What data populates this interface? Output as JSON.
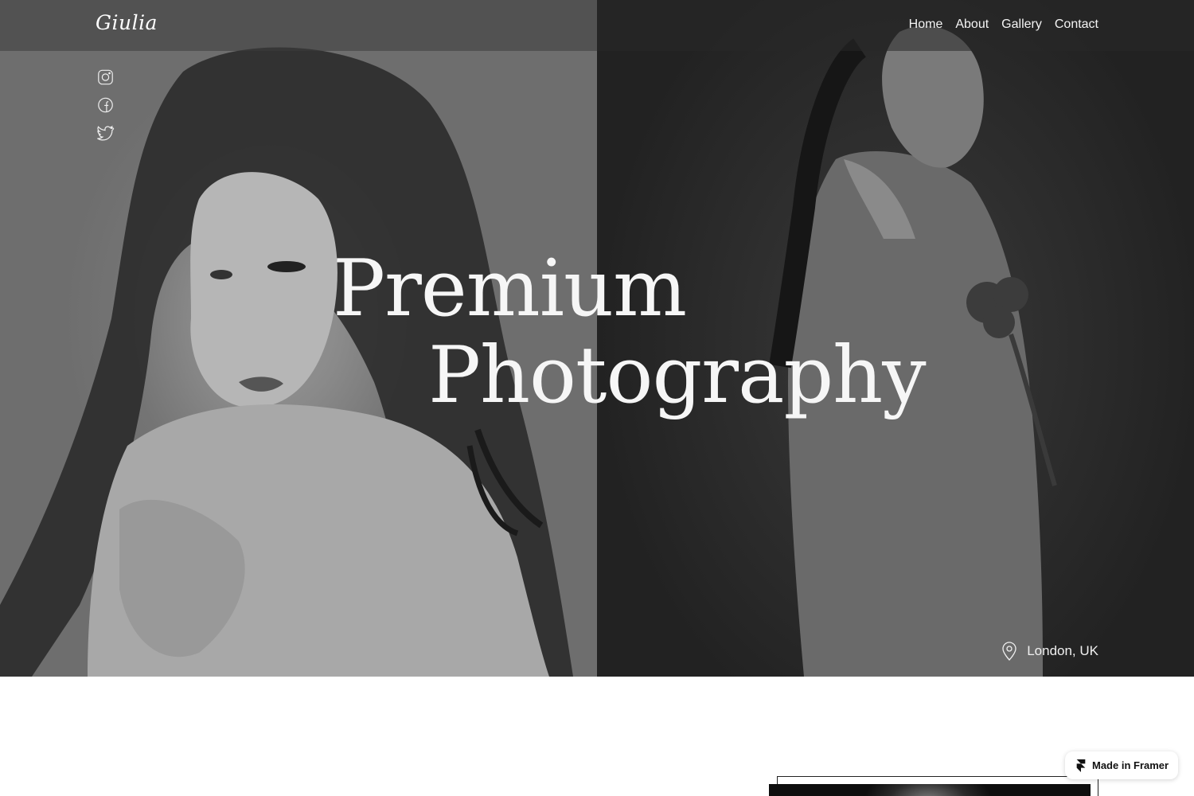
{
  "brand": {
    "logo_text": "Giulia"
  },
  "nav": {
    "items": [
      "Home",
      "About",
      "Gallery",
      "Contact"
    ]
  },
  "social": {
    "icons": [
      "instagram-icon",
      "facebook-icon",
      "twitter-icon"
    ]
  },
  "hero": {
    "headline_line1": "Premium",
    "headline_line2": "Photography",
    "location": "London, UK"
  },
  "badge": {
    "label": "Made in Framer"
  },
  "colors": {
    "text": "#ffffff",
    "left_bg": "#7a7a7a",
    "right_bg": "#2a2a2a",
    "page": "#ffffff"
  }
}
